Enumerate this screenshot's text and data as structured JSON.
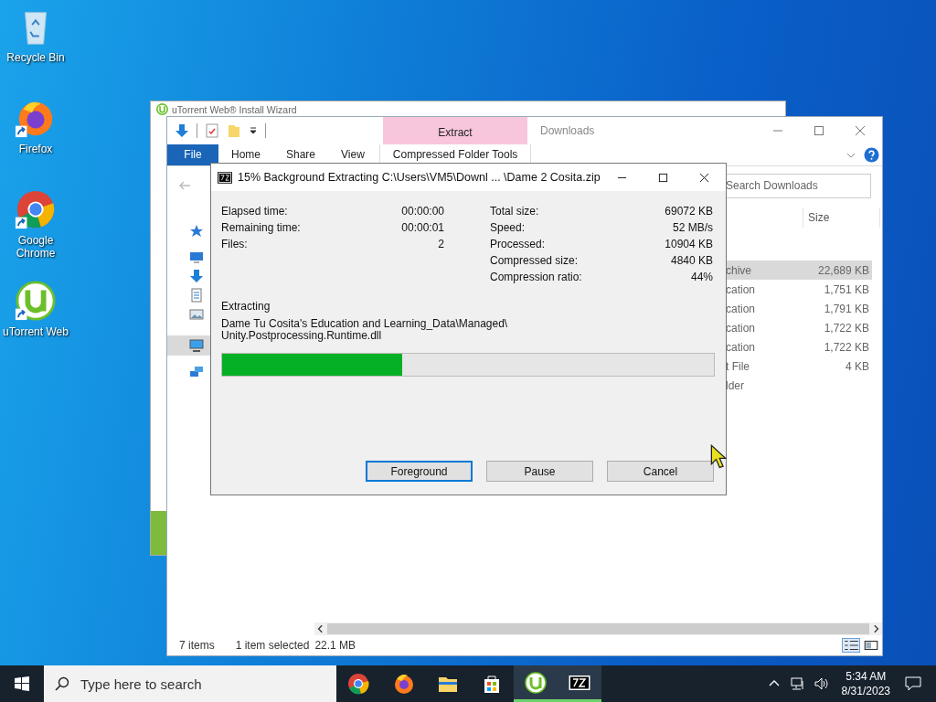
{
  "desktop_icons": [
    {
      "label": "Recycle Bin",
      "kind": "recycle",
      "shortcut": false
    },
    {
      "label": "Firefox",
      "kind": "firefox",
      "shortcut": true
    },
    {
      "label": "Google Chrome",
      "kind": "chrome",
      "shortcut": true
    },
    {
      "label": "uTorrent Web",
      "kind": "utorrent",
      "shortcut": true
    }
  ],
  "wizard_window": {
    "title": "uTorrent Web® Install Wizard"
  },
  "explorer": {
    "title": "Downloads",
    "context_tab": "Extract",
    "ribbon_tabs": [
      {
        "label": "File",
        "kind": "file"
      },
      {
        "label": "Home",
        "kind": "tab"
      },
      {
        "label": "Share",
        "kind": "tab"
      },
      {
        "label": "View",
        "kind": "tab"
      },
      {
        "label": "Compressed Folder Tools",
        "kind": "context"
      }
    ],
    "search": {
      "placeholder": "Search Downloads"
    },
    "columns": [
      "Size"
    ],
    "rows": [
      {
        "type": "chive",
        "size": "22,689 KB",
        "selected": true
      },
      {
        "type": "cation",
        "size": "1,751 KB",
        "selected": false
      },
      {
        "type": "cation",
        "size": "1,791 KB",
        "selected": false
      },
      {
        "type": "cation",
        "size": "1,722 KB",
        "selected": false
      },
      {
        "type": "cation",
        "size": "1,722 KB",
        "selected": false
      },
      {
        "type": "t File",
        "size": "4 KB",
        "selected": false
      },
      {
        "type": "lder",
        "size": "",
        "selected": false
      }
    ],
    "status": {
      "count": "7 items",
      "selection": "1 item selected",
      "selection_size": "22.1 MB"
    }
  },
  "dialog": {
    "title": "15% Background Extracting C:\\Users\\VM5\\Downl ... \\Dame 2 Cosita.zip",
    "stats_left": [
      {
        "label": "Elapsed time:",
        "value": "00:00:00"
      },
      {
        "label": "Remaining time:",
        "value": "00:00:01"
      },
      {
        "label": "Files:",
        "value": "2"
      }
    ],
    "stats_right": [
      {
        "label": "Total size:",
        "value": "69072 KB"
      },
      {
        "label": "Speed:",
        "value": "52 MB/s"
      },
      {
        "label": "Processed:",
        "value": "10904 KB"
      },
      {
        "label": "Compressed size:",
        "value": "4840 KB"
      },
      {
        "label": "Compression ratio:",
        "value": "44%"
      }
    ],
    "status": "Extracting",
    "path_lines": [
      "Dame Tu Cosita's Education and Learning_Data\\Managed\\",
      "Unity.Postprocessing.Runtime.dll"
    ],
    "progress": {
      "level": 0.366
    },
    "buttons": [
      {
        "label": "Foreground",
        "focused": true
      },
      {
        "label": "Pause",
        "focused": false
      },
      {
        "label": "Cancel",
        "focused": false
      }
    ]
  },
  "taskbar": {
    "search_placeholder": "Type here to search",
    "apps": [
      {
        "kind": "chrome",
        "active": false
      },
      {
        "kind": "firefox",
        "active": false
      },
      {
        "kind": "explorer",
        "active": false
      },
      {
        "kind": "store",
        "active": false
      },
      {
        "kind": "utorrent",
        "active": true
      },
      {
        "kind": "sevenzip",
        "active": true
      }
    ],
    "time": "5:34 AM",
    "date": "8/31/2023"
  }
}
